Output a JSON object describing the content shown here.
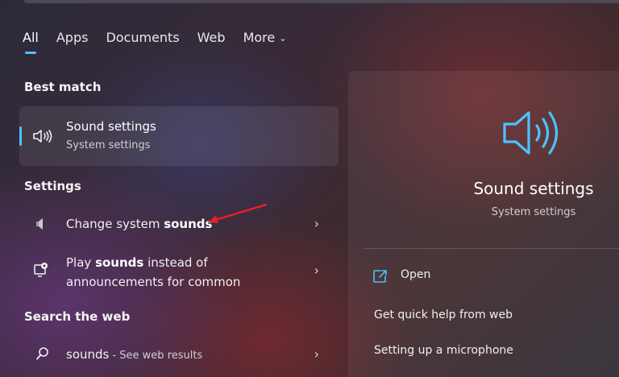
{
  "tabs": [
    {
      "label": "All"
    },
    {
      "label": "Apps"
    },
    {
      "label": "Documents"
    },
    {
      "label": "Web"
    },
    {
      "label": "More"
    }
  ],
  "best_match": {
    "heading": "Best match",
    "title": "Sound settings",
    "subtitle": "System settings"
  },
  "settings": {
    "heading": "Settings",
    "item1": {
      "pre": "Change system ",
      "bold": "sounds"
    },
    "item2": {
      "pre": "Play ",
      "bold": "sounds",
      "post": " instead of",
      "line2": "announcements for common"
    }
  },
  "web": {
    "heading": "Search the web",
    "query": "sounds",
    "suffix": " - See web results"
  },
  "preview": {
    "title": "Sound settings",
    "subtitle": "System settings",
    "open_label": "Open",
    "links": [
      "Get quick help from web",
      "Setting up a microphone"
    ]
  },
  "colors": {
    "accent": "#4cc2ff",
    "annotation": "#e0202a"
  }
}
